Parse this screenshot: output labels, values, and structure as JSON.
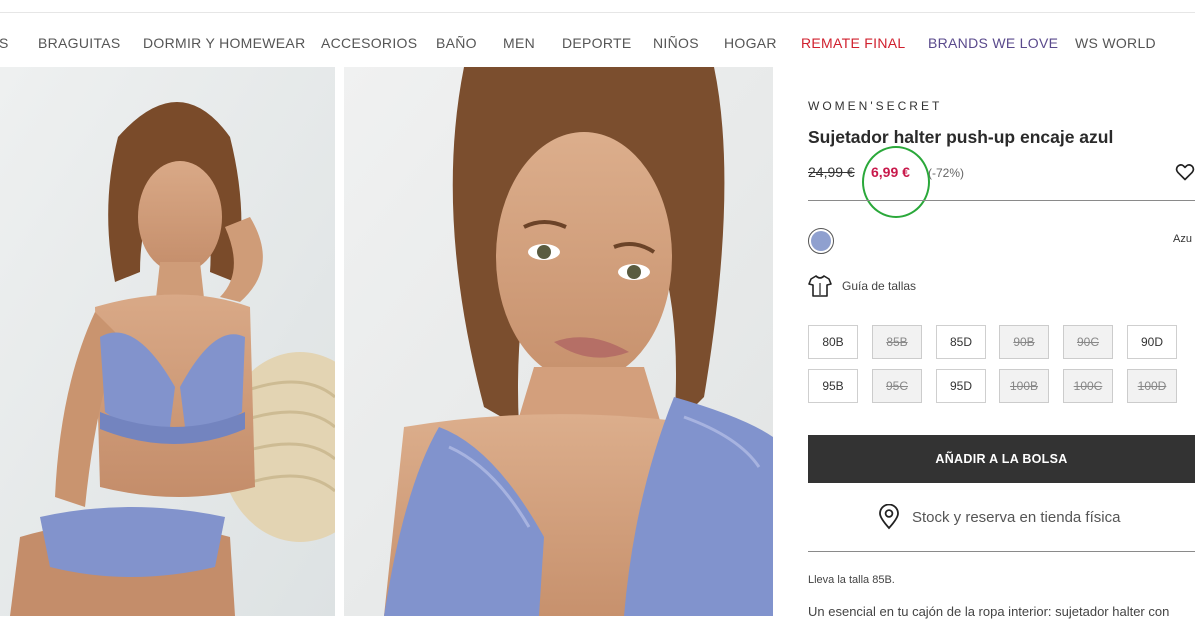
{
  "nav": {
    "items": [
      {
        "label": "S",
        "color": "#555555"
      },
      {
        "label": "BRAGUITAS",
        "color": "#555555"
      },
      {
        "label": "DORMIR Y HOMEWEAR",
        "color": "#555555"
      },
      {
        "label": "ACCESORIOS",
        "color": "#555555"
      },
      {
        "label": "BAÑO",
        "color": "#555555"
      },
      {
        "label": "MEN",
        "color": "#555555"
      },
      {
        "label": "DEPORTE",
        "color": "#555555"
      },
      {
        "label": "NIÑOS",
        "color": "#555555"
      },
      {
        "label": "HOGAR",
        "color": "#555555"
      },
      {
        "label": "REMATE FINAL",
        "color": "#d0202e"
      },
      {
        "label": "BRANDS WE LOVE",
        "color": "#5a4a8c"
      },
      {
        "label": "WS WORLD",
        "color": "#555555"
      }
    ]
  },
  "product": {
    "brand": "WOMEN'SECRET",
    "title": "Sujetador halter push-up encaje azul",
    "price_old": "24,99 €",
    "price_new": "6,99 €",
    "discount": "(-72%)",
    "wishlist_icon": "heart-icon",
    "color": {
      "swatch": "#8fa0cf",
      "name": "Azu"
    },
    "size_guide": {
      "icon": "shirt-icon",
      "label": "Guía de tallas"
    },
    "sizes": [
      {
        "label": "80B",
        "available": true
      },
      {
        "label": "85B",
        "available": false
      },
      {
        "label": "85D",
        "available": true
      },
      {
        "label": "90B",
        "available": false
      },
      {
        "label": "90C",
        "available": false
      },
      {
        "label": "90D",
        "available": true
      },
      {
        "label": "95B",
        "available": true
      },
      {
        "label": "95C",
        "available": false
      },
      {
        "label": "95D",
        "available": true
      },
      {
        "label": "100B",
        "available": false
      },
      {
        "label": "100C",
        "available": false
      },
      {
        "label": "100D",
        "available": false
      }
    ],
    "add_to_bag": "AÑADIR A LA BOLSA",
    "stock": {
      "icon": "location-pin-icon",
      "label": "Stock y reserva en tienda física"
    },
    "model_info": "Lleva la talla 85B.",
    "description": "Un esencial en tu cajón de la ropa interior: sujetador halter con"
  },
  "colors": {
    "price_sale": "#c8194b",
    "highlight": "#2aa83a",
    "button": "#333333"
  }
}
